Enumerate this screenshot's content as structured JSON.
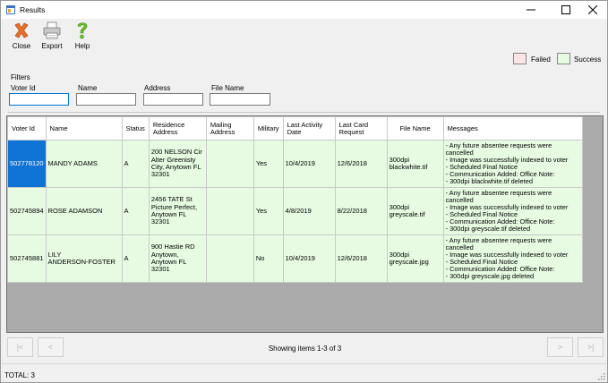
{
  "window": {
    "title": "Results"
  },
  "toolbar": {
    "close_label": "Close",
    "export_label": "Export",
    "help_label": "Help"
  },
  "legend": {
    "failed_label": "Failed",
    "success_label": "Success",
    "failed_color": "#fbe4e4",
    "success_color": "#e6fbe2"
  },
  "filters": {
    "title": "Filters",
    "voter_id_label": "Voter Id",
    "name_label": "Name",
    "address_label": "Address",
    "file_name_label": "File Name",
    "voter_id_value": "",
    "name_value": "",
    "address_value": "",
    "file_name_value": ""
  },
  "grid": {
    "headers": [
      "Voter Id",
      "Name",
      "Status",
      "Residence\nAddress",
      "Mailing\nAddress",
      "Military",
      "Last Activity\nDate",
      "Last Card\nRequest",
      "File Name",
      "Messages"
    ],
    "rows": [
      {
        "voter_id": "502778120",
        "name": "MANDY ADAMS",
        "status": "A",
        "residence": "200 NELSON Cir\nAlter Greenisty\nCity, Anytown FL\n32301",
        "mailing": "",
        "military": "Yes",
        "last_activity": "10/4/2019",
        "last_card": "12/6/2018",
        "file_name": "300dpi\nblackwhite.tif",
        "messages": "- Any future absentee requests were cancelled\n- Image was successfully indexed to voter\n- Scheduled Final Notice\n- Communication Added: Office Note:\n- 300dpi blackwhite.tif deleted"
      },
      {
        "voter_id": "502745894",
        "name": "ROSE ADAMSON",
        "status": "A",
        "residence": "2456 TATE St\nPicture Perfect,\nAnytown FL\n32301",
        "mailing": "",
        "military": "Yes",
        "last_activity": "4/8/2019",
        "last_card": "8/22/2018",
        "file_name": "300dpi\ngreyscale.tif",
        "messages": "- Any future absentee requests were cancelled\n- Image was successfully indexed to voter\n- Scheduled Final Notice\n- Communication Added: Office Note:\n- 300dpi greyscale.tif deleted"
      },
      {
        "voter_id": "502745881",
        "name": "LILY\nANDERSON-FOSTER",
        "status": "A",
        "residence": "900 Hastie RD\nAnytown,\nAnytown FL\n32301",
        "mailing": "",
        "military": "No",
        "last_activity": "10/4/2019",
        "last_card": "12/6/2018",
        "file_name": "300dpi\ngreyscale.jpg",
        "messages": "- Any future absentee requests were cancelled\n- Image was successfully indexed to voter\n- Scheduled Final Notice\n- Communication Added: Office Note:\n- 300dpi greyscale.jpg deleted"
      }
    ]
  },
  "pager": {
    "first_label": "|<",
    "prev_label": "<",
    "next_label": ">",
    "last_label": ">|",
    "status_text": "Showing items 1-3 of 3"
  },
  "status": {
    "total_text": "TOTAL: 3"
  }
}
